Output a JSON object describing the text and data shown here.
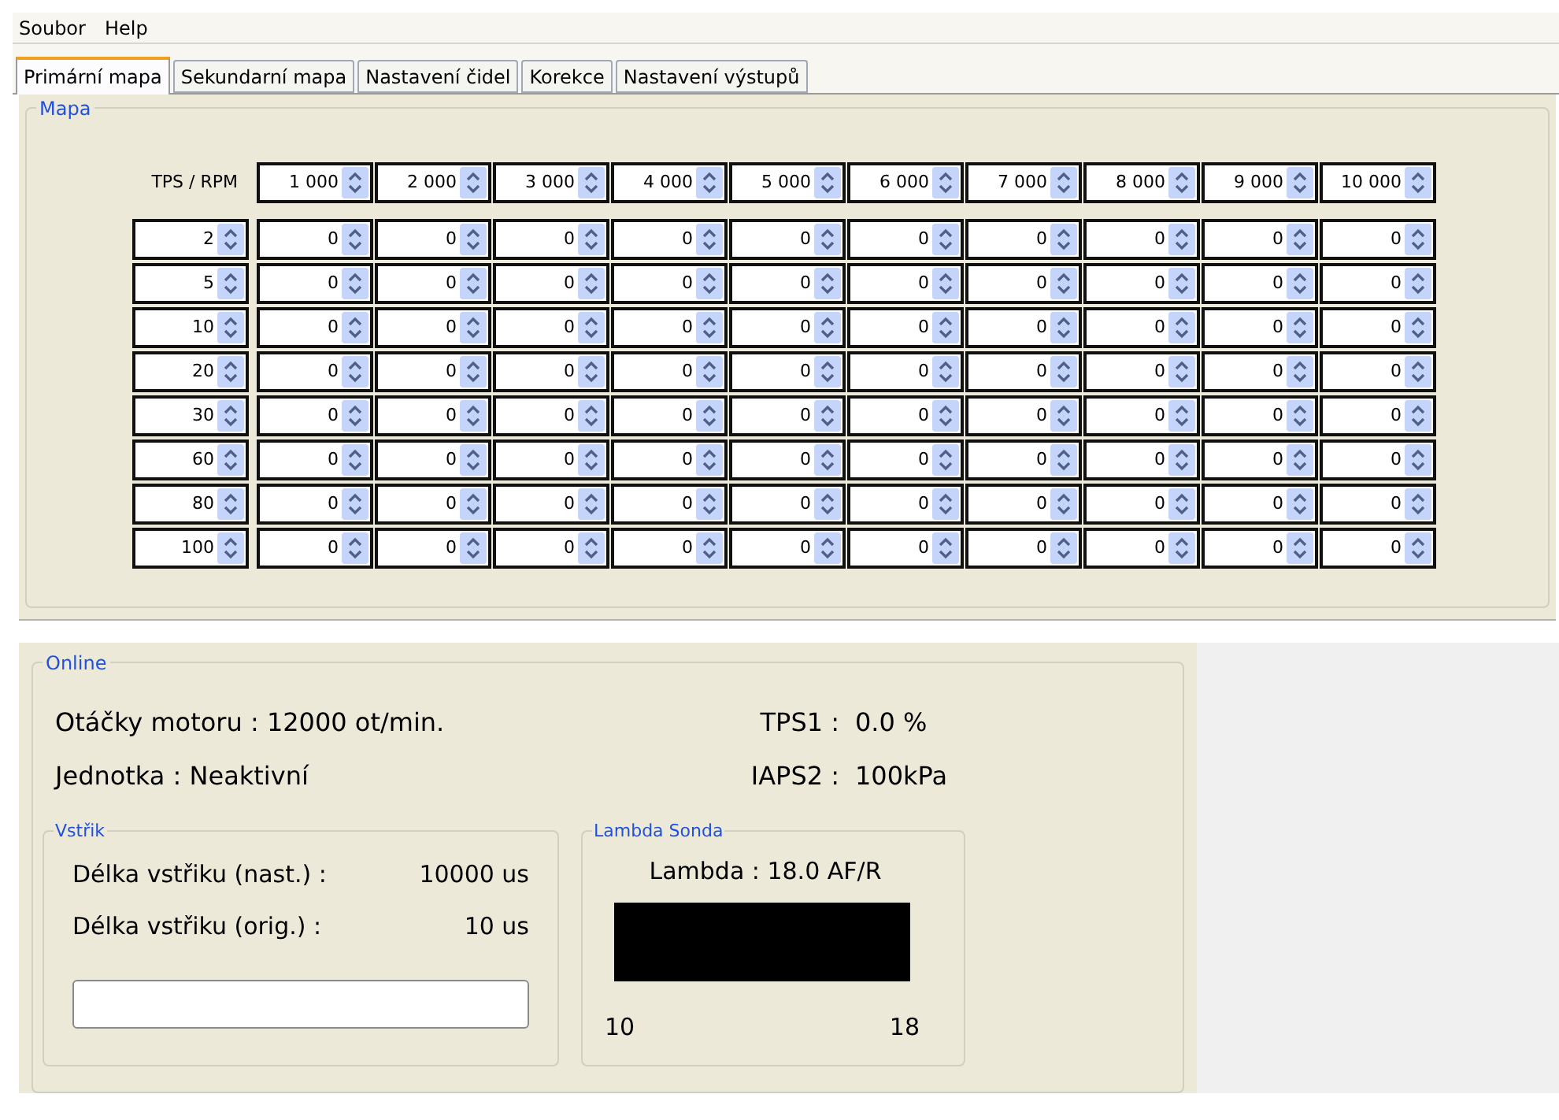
{
  "menu": [
    "Soubor",
    "Help"
  ],
  "tabs": [
    {
      "label": "Primární mapa",
      "selected": true
    },
    {
      "label": "Sekundarní mapa",
      "selected": false
    },
    {
      "label": "Nastavení čidel",
      "selected": false
    },
    {
      "label": "Korekce",
      "selected": false
    },
    {
      "label": "Nastavení výstupů",
      "selected": false
    }
  ],
  "map": {
    "title": "Mapa",
    "corner": "TPS / RPM",
    "rpm": [
      "1 000",
      "2 000",
      "3 000",
      "4 000",
      "5 000",
      "6 000",
      "7 000",
      "8 000",
      "9 000",
      "10 000"
    ],
    "rows": [
      {
        "tps": "2",
        "values": [
          "0",
          "0",
          "0",
          "0",
          "0",
          "0",
          "0",
          "0",
          "0",
          "0"
        ]
      },
      {
        "tps": "5",
        "values": [
          "0",
          "0",
          "0",
          "0",
          "0",
          "0",
          "0",
          "0",
          "0",
          "0"
        ]
      },
      {
        "tps": "10",
        "values": [
          "0",
          "0",
          "0",
          "0",
          "0",
          "0",
          "0",
          "0",
          "0",
          "0"
        ]
      },
      {
        "tps": "20",
        "values": [
          "0",
          "0",
          "0",
          "0",
          "0",
          "0",
          "0",
          "0",
          "0",
          "0"
        ]
      },
      {
        "tps": "30",
        "values": [
          "0",
          "0",
          "0",
          "0",
          "0",
          "0",
          "0",
          "0",
          "0",
          "0"
        ]
      },
      {
        "tps": "60",
        "values": [
          "0",
          "0",
          "0",
          "0",
          "0",
          "0",
          "0",
          "0",
          "0",
          "0"
        ]
      },
      {
        "tps": "80",
        "values": [
          "0",
          "0",
          "0",
          "0",
          "0",
          "0",
          "0",
          "0",
          "0",
          "0"
        ]
      },
      {
        "tps": "100",
        "values": [
          "0",
          "0",
          "0",
          "0",
          "0",
          "0",
          "0",
          "0",
          "0",
          "0"
        ]
      }
    ]
  },
  "online": {
    "title": "Online",
    "status": [
      "Otáčky motoru : 12000 ot/min.",
      "Jednotka  : Neaktivní"
    ],
    "sensors": [
      {
        "label": "TPS1 :",
        "value": "0.0 %"
      },
      {
        "label": "IAPS2 :",
        "value": "100kPa"
      }
    ],
    "injection": {
      "title": "Vstřik",
      "rows": [
        {
          "label": "Délka vstřiku (nast.) :",
          "value": "10000 us"
        },
        {
          "label": "Délka vstřiku (orig.) :",
          "value": "10 us"
        }
      ]
    },
    "lambda": {
      "title": "Lambda Sonda",
      "reading": "Lambda : 18.0 AF/R",
      "level": 1,
      "min": "10",
      "max": "18"
    }
  }
}
